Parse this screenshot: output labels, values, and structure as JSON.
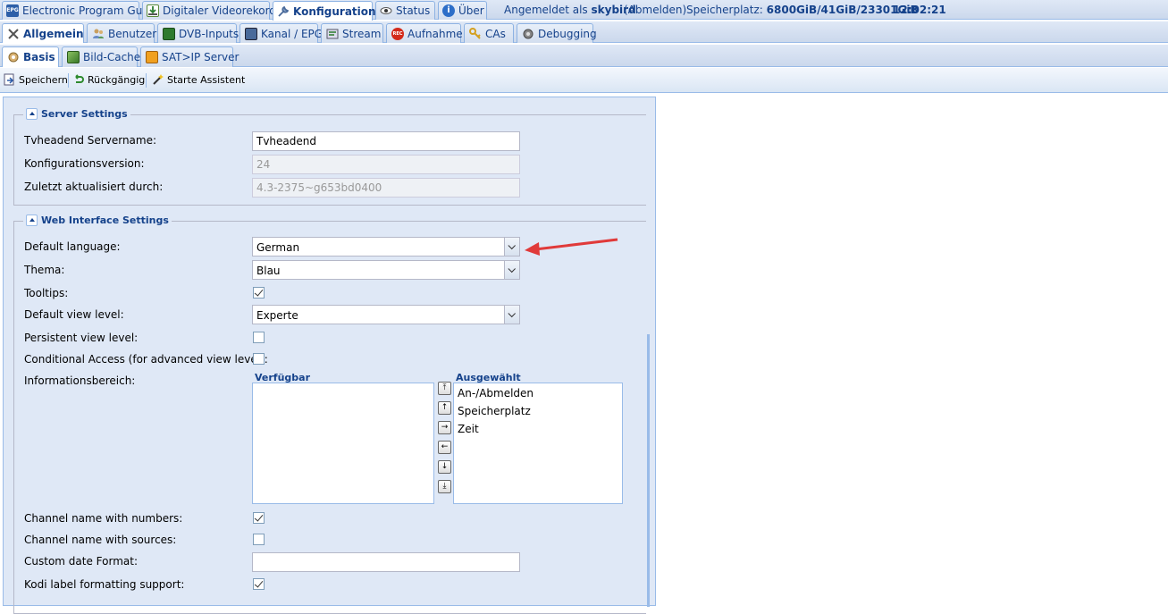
{
  "top_tabs": [
    {
      "label": "Electronic Program Guide",
      "icon": "epg-icon"
    },
    {
      "label": "Digitaler Videorekorder",
      "icon": "download-icon"
    },
    {
      "label": "Konfiguration",
      "icon": "wrench-icon"
    },
    {
      "label": "Status",
      "icon": "eye-icon"
    },
    {
      "label": "Über",
      "icon": "info-icon"
    }
  ],
  "header_info": {
    "logged_in_prefix": "Angemeldet als",
    "username": "skybird",
    "logout": "(Abmelden)",
    "storage_prefix": "Speicherplatz:",
    "storage_value": "6800GiB/41GiB/23301GiB",
    "time": "12:02:21"
  },
  "config_tabs": [
    {
      "label": "Allgemein"
    },
    {
      "label": "Benutzer"
    },
    {
      "label": "DVB-Inputs"
    },
    {
      "label": "Kanal / EPG"
    },
    {
      "label": "Stream"
    },
    {
      "label": "Aufnahme"
    },
    {
      "label": "CAs"
    },
    {
      "label": "Debugging"
    }
  ],
  "sub_tabs": [
    {
      "label": "Basis"
    },
    {
      "label": "Bild-Cache"
    },
    {
      "label": "SAT>IP Server"
    }
  ],
  "toolbar": {
    "save": "Speichern",
    "undo": "Rückgängig",
    "wizard": "Starte Assistent"
  },
  "server_settings": {
    "title": "Server Settings",
    "servername_label": "Tvheadend Servername:",
    "servername_value": "Tvheadend",
    "config_version_label": "Konfigurationsversion:",
    "config_version_value": "24",
    "updated_by_label": "Zuletzt aktualisiert durch:",
    "updated_by_value": "4.3-2375~g653bd0400"
  },
  "web_settings": {
    "title": "Web Interface Settings",
    "language_label": "Default language:",
    "language_value": "German",
    "theme_label": "Thema:",
    "theme_value": "Blau",
    "tooltips_label": "Tooltips:",
    "tooltips_checked": true,
    "view_level_label": "Default view level:",
    "view_level_value": "Experte",
    "persistent_label": "Persistent view level:",
    "persistent_checked": false,
    "ca_label": "Conditional Access (for advanced view level):",
    "ca_checked": false,
    "info_area_label": "Informationsbereich:",
    "available_header": "Verfügbar",
    "selected_header": "Ausgewählt",
    "available_items": [],
    "selected_items": [
      "An-/Abmelden",
      "Speicherplatz",
      "Zeit"
    ],
    "chnum_label": "Channel name with numbers:",
    "chnum_checked": true,
    "chsrc_label": "Channel name with sources:",
    "chsrc_checked": false,
    "date_format_label": "Custom date Format:",
    "date_format_value": "",
    "kodi_label": "Kodi label formatting support:",
    "kodi_checked": true
  },
  "colors": {
    "accent": "#15428b",
    "panel_bg": "#dfe8f6",
    "border": "#99bbe8",
    "annotation_arrow": "#e03a3a"
  }
}
